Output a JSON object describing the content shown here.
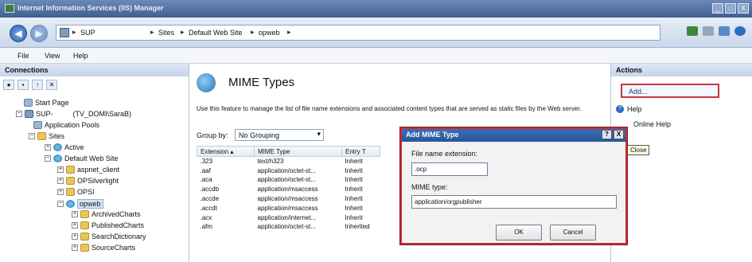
{
  "window": {
    "title": "Internet Information Services (IIS) Manager",
    "controls": [
      "_",
      "□",
      "X"
    ]
  },
  "address": {
    "crumbs": [
      "SUP",
      "Sites",
      "Default Web Site",
      "opweb"
    ],
    "separator": "▸"
  },
  "menu": {
    "items": [
      "File",
      "View",
      "Help"
    ]
  },
  "connections": {
    "header": "Connections",
    "tree": [
      {
        "label": "Start Page"
      },
      {
        "label": "SUP-",
        "extra": "(TV_DOMI\\SaraB)"
      },
      {
        "label": "Application Pools"
      },
      {
        "label": "Sites"
      },
      {
        "label": "Active"
      },
      {
        "label": "Default Web Site"
      },
      {
        "label": "aspnet_client"
      },
      {
        "label": "OPSilverlight"
      },
      {
        "label": "OPSI"
      },
      {
        "label": "opweb"
      },
      {
        "label": "ArchivedCharts"
      },
      {
        "label": "PublishedCharts"
      },
      {
        "label": "SearchDictionary"
      },
      {
        "label": "SourceCharts"
      }
    ]
  },
  "center": {
    "title": "MIME Types",
    "description": "Use this feature to manage the list of file name extensions and associated content types that are served as static files by the Web server.",
    "group_by_label": "Group by:",
    "group_by_value": "No Grouping",
    "columns": [
      "Extension",
      "MIME Type",
      "Entry T"
    ],
    "rows": [
      [
        ".323",
        "text/h323",
        "Inherit"
      ],
      [
        ".aaf",
        "application/octet-st...",
        "Inherit"
      ],
      [
        ".aca",
        "application/octet-st...",
        "Inherit"
      ],
      [
        ".accdb",
        "application/msaccess",
        "Inherit"
      ],
      [
        ".accde",
        "application/msaccess",
        "Inherit"
      ],
      [
        ".accdt",
        "application/msaccess",
        "Inherit"
      ],
      [
        ".acx",
        "application/internet...",
        "Inherit"
      ],
      [
        ".afm",
        "application/octet-st...",
        "Inherited"
      ]
    ]
  },
  "actions": {
    "header": "Actions",
    "add": "Add...",
    "help": "Help",
    "online_help": "Online Help",
    "tooltip": "Close"
  },
  "dialog": {
    "title": "Add MIME Type",
    "help_btn": "?",
    "close_btn": "X",
    "ext_label": "File name extension:",
    "ext_value": ".ocp",
    "mime_label": "MIME type:",
    "mime_value": "application/orgpublisher",
    "ok": "OK",
    "cancel": "Cancel"
  }
}
